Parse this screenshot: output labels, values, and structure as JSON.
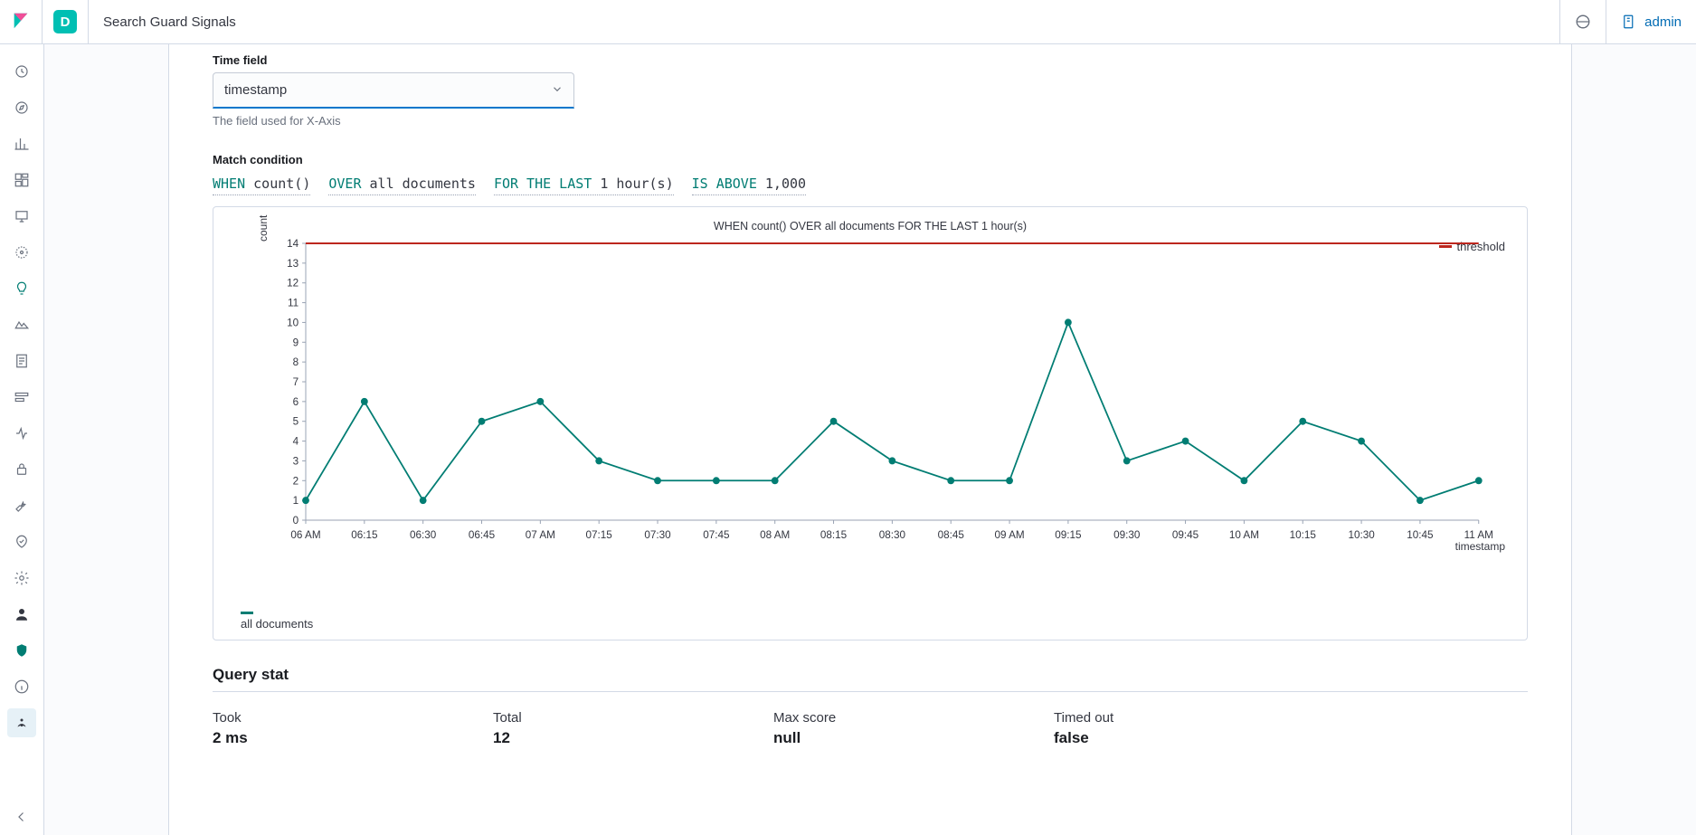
{
  "header": {
    "space_letter": "D",
    "breadcrumb": "Search Guard Signals",
    "user": "admin"
  },
  "time_field": {
    "label": "Time field",
    "value": "timestamp",
    "help": "The field used for X-Axis"
  },
  "condition": {
    "label": "Match condition",
    "segments": [
      {
        "kw": "WHEN",
        "val": "count()"
      },
      {
        "kw": "OVER",
        "val": "all documents"
      },
      {
        "kw": "FOR THE LAST",
        "val": "1 hour(s)"
      },
      {
        "kw": "IS ABOVE",
        "val": "1,000"
      }
    ]
  },
  "chart_data": {
    "type": "line",
    "title": "WHEN count() OVER all documents FOR THE LAST 1 hour(s)",
    "ylabel": "count",
    "xlabel": "timestamp",
    "legend_series": "all documents",
    "legend_threshold": "threshold",
    "threshold_line_y": 14,
    "ylim": [
      0,
      14
    ],
    "yticks": [
      0,
      1,
      2,
      3,
      4,
      5,
      6,
      7,
      8,
      9,
      10,
      11,
      12,
      13,
      14
    ],
    "categories": [
      "06 AM",
      "06:15",
      "06:30",
      "06:45",
      "07 AM",
      "07:15",
      "07:30",
      "07:45",
      "08 AM",
      "08:15",
      "08:30",
      "08:45",
      "09 AM",
      "09:15",
      "09:30",
      "09:45",
      "10 AM",
      "10:15",
      "10:30",
      "10:45",
      "11 AM"
    ],
    "series": [
      {
        "name": "all documents",
        "values": [
          1,
          6,
          1,
          5,
          6,
          3,
          2,
          2,
          2,
          5,
          3,
          2,
          2,
          10,
          3,
          4,
          2,
          5,
          4,
          1,
          2
        ]
      }
    ]
  },
  "query_stat": {
    "heading": "Query stat",
    "items": [
      {
        "label": "Took",
        "value": "2 ms"
      },
      {
        "label": "Total",
        "value": "12"
      },
      {
        "label": "Max score",
        "value": "null"
      },
      {
        "label": "Timed out",
        "value": "false"
      }
    ]
  }
}
